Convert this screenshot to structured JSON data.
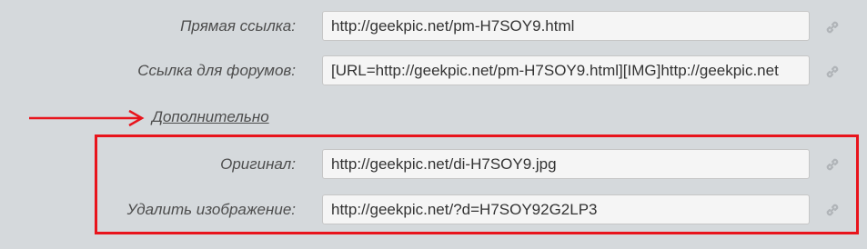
{
  "rows": [
    {
      "label": "Прямая ссылка:",
      "value": "http://geekpic.net/pm-H7SOY9.html"
    },
    {
      "label": "Ссылка для форумов:",
      "value": "[URL=http://geekpic.net/pm-H7SOY9.html][IMG]http://geekpic.net"
    }
  ],
  "more_link": "Дополнительно",
  "extra_rows": [
    {
      "label": "Оригинал:",
      "value": "http://geekpic.net/di-H7SOY9.jpg"
    },
    {
      "label": "Удалить изображение:",
      "value": "http://geekpic.net/?d=H7SOY92G2LP3"
    }
  ],
  "icons": {
    "copy_link": "chain-link-icon",
    "annotation_arrow": "red-arrow-icon"
  },
  "colors": {
    "background": "#d5d9dc",
    "annotation": "#e8141c",
    "field_bg": "#f5f5f5",
    "icon": "#b0b4b8"
  }
}
